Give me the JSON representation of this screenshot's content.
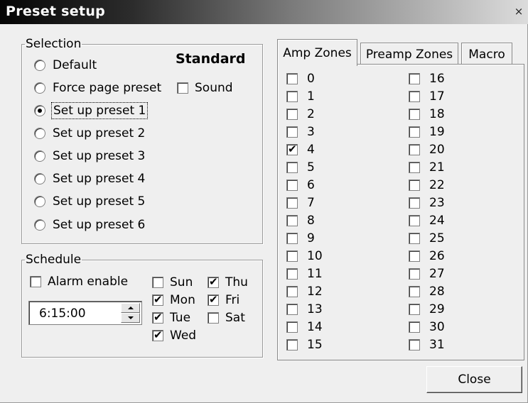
{
  "window": {
    "title": "Preset setup",
    "close_glyph": "×"
  },
  "selection": {
    "legend": "Selection",
    "standard_label": "Standard",
    "options": [
      {
        "label": "Default",
        "checked": false
      },
      {
        "label": "Force page preset",
        "checked": false
      },
      {
        "label": "Set up preset 1",
        "checked": true
      },
      {
        "label": "Set up preset 2",
        "checked": false
      },
      {
        "label": "Set up preset 3",
        "checked": false
      },
      {
        "label": "Set up preset 4",
        "checked": false
      },
      {
        "label": "Set up preset 5",
        "checked": false
      },
      {
        "label": "Set up preset 6",
        "checked": false
      }
    ],
    "sound": {
      "label": "Sound",
      "checked": false
    }
  },
  "schedule": {
    "legend": "Schedule",
    "alarm": {
      "label": "Alarm enable",
      "checked": false
    },
    "time": "6:15:00",
    "days": [
      {
        "label": "Sun",
        "checked": false
      },
      {
        "label": "Mon",
        "checked": true
      },
      {
        "label": "Tue",
        "checked": true
      },
      {
        "label": "Wed",
        "checked": true
      },
      {
        "label": "Thu",
        "checked": true
      },
      {
        "label": "Fri",
        "checked": true
      },
      {
        "label": "Sat",
        "checked": false
      }
    ]
  },
  "tabs": [
    {
      "label": "Amp Zones",
      "active": true
    },
    {
      "label": "Preamp Zones",
      "active": false
    },
    {
      "label": "Macro",
      "active": false
    }
  ],
  "zones": [
    {
      "label": "0",
      "checked": false
    },
    {
      "label": "1",
      "checked": false
    },
    {
      "label": "2",
      "checked": false
    },
    {
      "label": "3",
      "checked": false
    },
    {
      "label": "4",
      "checked": true
    },
    {
      "label": "5",
      "checked": false
    },
    {
      "label": "6",
      "checked": false
    },
    {
      "label": "7",
      "checked": false
    },
    {
      "label": "8",
      "checked": false
    },
    {
      "label": "9",
      "checked": false
    },
    {
      "label": "10",
      "checked": false
    },
    {
      "label": "11",
      "checked": false
    },
    {
      "label": "12",
      "checked": false
    },
    {
      "label": "13",
      "checked": false
    },
    {
      "label": "14",
      "checked": false
    },
    {
      "label": "15",
      "checked": false
    },
    {
      "label": "16",
      "checked": false
    },
    {
      "label": "17",
      "checked": false
    },
    {
      "label": "18",
      "checked": false
    },
    {
      "label": "19",
      "checked": false
    },
    {
      "label": "20",
      "checked": false
    },
    {
      "label": "21",
      "checked": false
    },
    {
      "label": "22",
      "checked": false
    },
    {
      "label": "23",
      "checked": false
    },
    {
      "label": "24",
      "checked": false
    },
    {
      "label": "25",
      "checked": false
    },
    {
      "label": "26",
      "checked": false
    },
    {
      "label": "27",
      "checked": false
    },
    {
      "label": "28",
      "checked": false
    },
    {
      "label": "29",
      "checked": false
    },
    {
      "label": "30",
      "checked": false
    },
    {
      "label": "31",
      "checked": false
    }
  ],
  "buttons": {
    "close": "Close"
  }
}
